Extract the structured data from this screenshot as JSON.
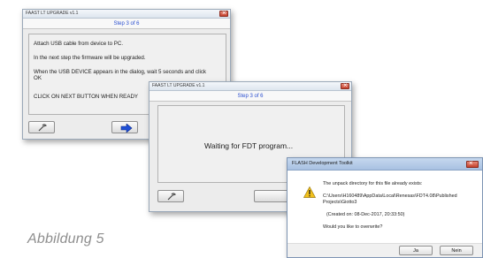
{
  "win1": {
    "title": "FAAST LT UPGRADE v1.1",
    "step": "Step 3 of 6",
    "line1": "Attach USB cable from device to PC.",
    "line2": "In the next step the firmware will be upgraded.",
    "line3a": "When the USB DEVICE appears in the dialog, wait 5 seconds and click",
    "line3b": "OK",
    "line4": "CLICK ON NEXT BUTTON WHEN READY"
  },
  "win2": {
    "title": "FAAST LT UPGRADE v1.1",
    "step": "Step 3 of 6",
    "status": "Waiting for FDT program..."
  },
  "win3": {
    "title": "FLASH Development Toolkit",
    "message": "The unpack directory for this file already exists:",
    "path1": "C:\\Users\\H160489\\AppData\\Local\\Renesas\\FDT4.08\\Published",
    "path2": "Projects\\Giotto3",
    "created": "(Created on: 08-Dec-2017, 20:33:50)",
    "question": "Would you like to overwrite?",
    "yes_label": "Ja",
    "no_label": "Nein"
  },
  "caption": "Abbildung 5",
  "icons": {
    "back": "wrench-back-icon",
    "next": "arrow-right-icon",
    "warning": "warning-icon"
  },
  "colors": {
    "step_text": "#2b4fd0",
    "next_arrow": "#1f4fd6",
    "warning": "#f2c11c"
  }
}
